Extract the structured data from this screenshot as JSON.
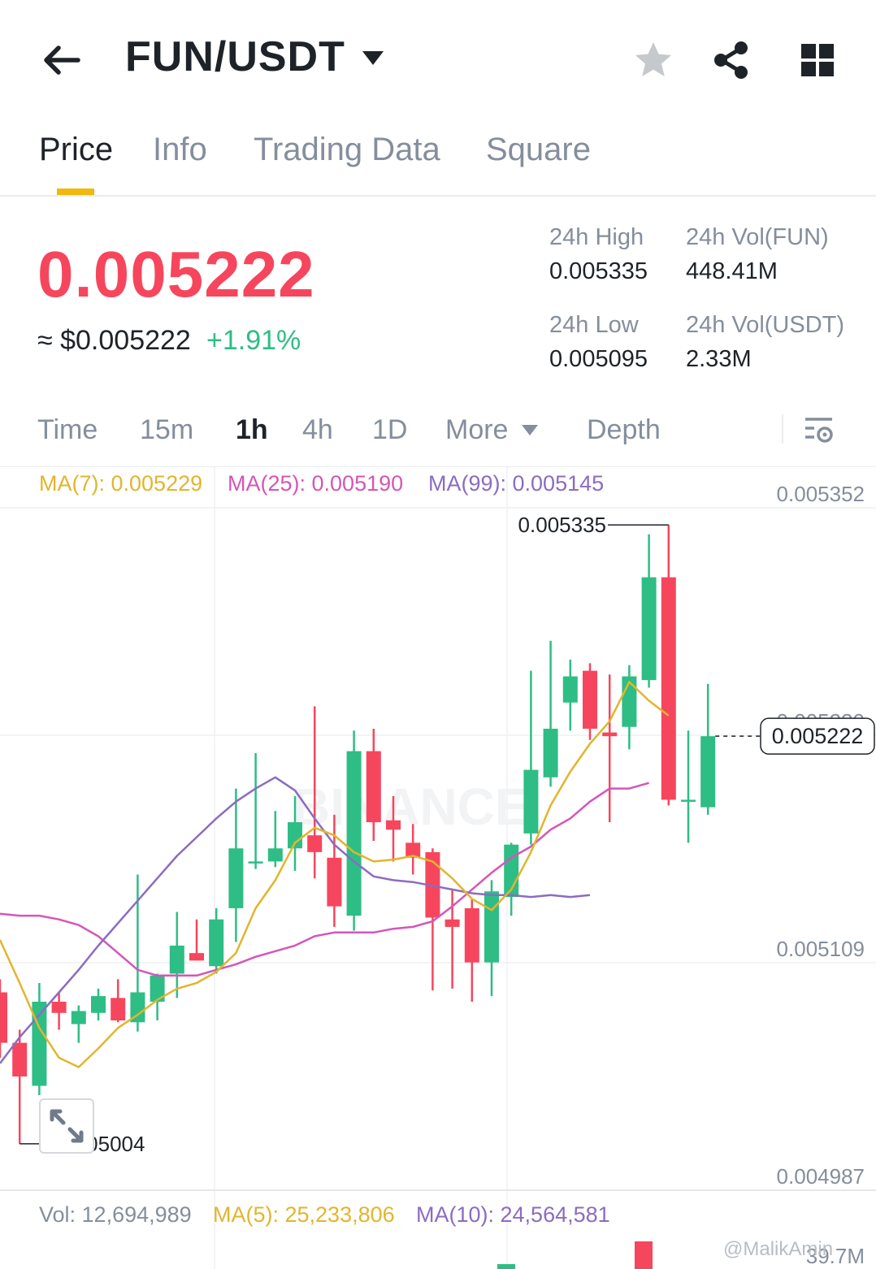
{
  "header": {
    "pair": "FUN/USDT",
    "icons": [
      "back-arrow-icon",
      "caret-down-icon",
      "star-icon",
      "share-icon",
      "grid-icon"
    ]
  },
  "tabs": [
    "Price",
    "Info",
    "Trading Data",
    "Square"
  ],
  "active_tab": "Price",
  "price": {
    "last": "0.005222",
    "fiat": "≈ $0.005222",
    "change_pct": "+1.91%"
  },
  "stats": {
    "high_label": "24h High",
    "high_value": "0.005335",
    "low_label": "24h Low",
    "low_value": "0.005095",
    "vol_base_label": "24h Vol(FUN)",
    "vol_base_value": "448.41M",
    "vol_quote_label": "24h Vol(USDT)",
    "vol_quote_value": "2.33M"
  },
  "intervals": {
    "time": "Time",
    "m15": "15m",
    "h1": "1h",
    "h4": "4h",
    "d1": "1D",
    "more": "More",
    "depth": "Depth",
    "active": "1h"
  },
  "ma_legend": {
    "ma7": "MA(7): 0.005229",
    "ma25": "MA(25): 0.005190",
    "ma99": "MA(99): 0.005145"
  },
  "vol_legend": {
    "vol": "Vol: 12,694,989",
    "ma5": "MA(5): 25,233,806",
    "ma10": "MA(10): 24,564,581",
    "tail": "39.7M"
  },
  "watermark": "@MalikAmin",
  "colors": {
    "up": "#2ebd85",
    "down": "#f6465d",
    "accent": "#f0b90b",
    "ma7": "#e2b52d",
    "ma25": "#d456b8",
    "ma99": "#8b6cc1"
  },
  "chart_data": {
    "type": "candlestick",
    "y_ticks": [
      "0.005352",
      "0.005230",
      "0.005109",
      "0.004987"
    ],
    "ylim": [
      0.004987,
      0.005352
    ],
    "high_label": "0.005335",
    "low_label": "0.005004",
    "last_label": "0.005222",
    "candles": [
      {
        "o": 0.005085,
        "h": 0.005092,
        "l": 0.00505,
        "c": 0.005058
      },
      {
        "o": 0.005058,
        "h": 0.005065,
        "l": 0.005004,
        "c": 0.00504
      },
      {
        "o": 0.005035,
        "h": 0.00509,
        "l": 0.00503,
        "c": 0.00508
      },
      {
        "o": 0.00508,
        "h": 0.005085,
        "l": 0.005065,
        "c": 0.005074
      },
      {
        "o": 0.005068,
        "h": 0.005078,
        "l": 0.005058,
        "c": 0.005075
      },
      {
        "o": 0.005074,
        "h": 0.005087,
        "l": 0.00507,
        "c": 0.005083
      },
      {
        "o": 0.005082,
        "h": 0.005092,
        "l": 0.005069,
        "c": 0.00507
      },
      {
        "o": 0.005069,
        "h": 0.005148,
        "l": 0.005064,
        "c": 0.005085
      },
      {
        "o": 0.00508,
        "h": 0.005095,
        "l": 0.00507,
        "c": 0.005094
      },
      {
        "o": 0.005095,
        "h": 0.005128,
        "l": 0.005082,
        "c": 0.00511
      },
      {
        "o": 0.005106,
        "h": 0.005124,
        "l": 0.005102,
        "c": 0.005102
      },
      {
        "o": 0.005099,
        "h": 0.00513,
        "l": 0.005095,
        "c": 0.005124
      },
      {
        "o": 0.00513,
        "h": 0.005194,
        "l": 0.005112,
        "c": 0.005162
      },
      {
        "o": 0.005155,
        "h": 0.005213,
        "l": 0.005151,
        "c": 0.005155
      },
      {
        "o": 0.005155,
        "h": 0.005182,
        "l": 0.005152,
        "c": 0.005162
      },
      {
        "o": 0.005162,
        "h": 0.00519,
        "l": 0.00515,
        "c": 0.005176
      },
      {
        "o": 0.005169,
        "h": 0.005238,
        "l": 0.005146,
        "c": 0.00516
      },
      {
        "o": 0.005157,
        "h": 0.00518,
        "l": 0.00512,
        "c": 0.005131
      },
      {
        "o": 0.005126,
        "h": 0.005225,
        "l": 0.005118,
        "c": 0.005214
      },
      {
        "o": 0.005214,
        "h": 0.005226,
        "l": 0.005166,
        "c": 0.005176
      },
      {
        "o": 0.005177,
        "h": 0.00519,
        "l": 0.005155,
        "c": 0.005172
      },
      {
        "o": 0.005165,
        "h": 0.005175,
        "l": 0.005148,
        "c": 0.005157
      },
      {
        "o": 0.00516,
        "h": 0.005162,
        "l": 0.005086,
        "c": 0.005125
      },
      {
        "o": 0.005124,
        "h": 0.00514,
        "l": 0.005087,
        "c": 0.00512
      },
      {
        "o": 0.00513,
        "h": 0.005135,
        "l": 0.00508,
        "c": 0.005101
      },
      {
        "o": 0.005101,
        "h": 0.005145,
        "l": 0.005083,
        "c": 0.005139
      },
      {
        "o": 0.005136,
        "h": 0.005165,
        "l": 0.005126,
        "c": 0.005164
      },
      {
        "o": 0.00517,
        "h": 0.005257,
        "l": 0.005164,
        "c": 0.005204
      },
      {
        "o": 0.0052,
        "h": 0.005273,
        "l": 0.005195,
        "c": 0.005226
      },
      {
        "o": 0.00524,
        "h": 0.005263,
        "l": 0.005225,
        "c": 0.005254
      },
      {
        "o": 0.005257,
        "h": 0.005261,
        "l": 0.00522,
        "c": 0.005226
      },
      {
        "o": 0.005224,
        "h": 0.005255,
        "l": 0.005176,
        "c": 0.005222
      },
      {
        "o": 0.005227,
        "h": 0.00526,
        "l": 0.005215,
        "c": 0.005254
      },
      {
        "o": 0.005252,
        "h": 0.00533,
        "l": 0.005248,
        "c": 0.005307
      },
      {
        "o": 0.005307,
        "h": 0.005335,
        "l": 0.005185,
        "c": 0.005188
      },
      {
        "o": 0.005188,
        "h": 0.005225,
        "l": 0.005165,
        "c": 0.005188
      },
      {
        "o": 0.005184,
        "h": 0.00525,
        "l": 0.00518,
        "c": 0.005222
      }
    ],
    "ma7": [
      0.005113,
      0.00509,
      0.005066,
      0.00505,
      0.005045,
      0.005055,
      0.005066,
      0.005073,
      0.005081,
      0.005087,
      0.00509,
      0.005096,
      0.005106,
      0.00513,
      0.005145,
      0.005165,
      0.005173,
      0.005169,
      0.00516,
      0.005155,
      0.005156,
      0.005158,
      0.005155,
      0.005146,
      0.005135,
      0.005129,
      0.00514,
      0.00516,
      0.005185,
      0.005203,
      0.005218,
      0.00523,
      0.005251,
      0.005241,
      0.005233
    ],
    "ma25": [
      0.005127,
      0.005126,
      0.005126,
      0.005124,
      0.005121,
      0.005115,
      0.005106,
      0.005097,
      0.005094,
      0.005094,
      0.005094,
      0.005097,
      0.0051,
      0.005104,
      0.005107,
      0.00511,
      0.005115,
      0.005117,
      0.005117,
      0.005117,
      0.005119,
      0.00512,
      0.005123,
      0.005131,
      0.00514,
      0.005149,
      0.005157,
      0.005163,
      0.005172,
      0.005178,
      0.005187,
      0.005194,
      0.005194,
      0.005197
    ],
    "ma99_start_index": 0,
    "ma99": [
      0.005047,
      0.005061,
      0.005073,
      0.005085,
      0.005097,
      0.00511,
      0.005122,
      0.005134,
      0.005146,
      0.005158,
      0.005168,
      0.005178,
      0.005187,
      0.005194,
      0.0052,
      0.005193,
      0.005178,
      0.005164,
      0.005155,
      0.005147,
      0.005145,
      0.005144,
      0.005142,
      0.00514,
      0.005138,
      0.005137,
      0.005137,
      0.005136,
      0.005137,
      0.005136,
      0.005137
    ],
    "volume_last_bars": [
      {
        "dir": "up",
        "v": 0.15
      },
      {
        "dir": "down",
        "v": 1.0
      }
    ]
  }
}
